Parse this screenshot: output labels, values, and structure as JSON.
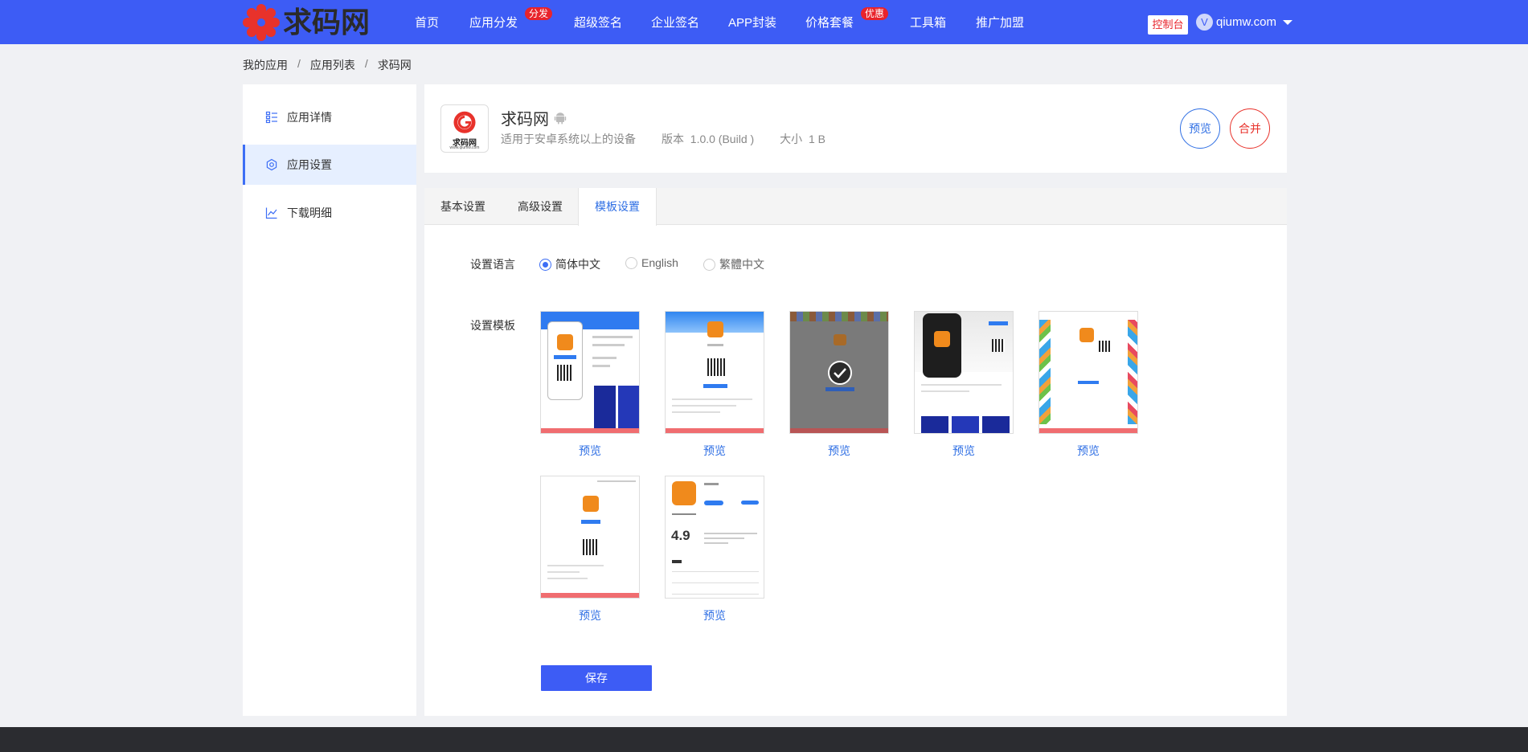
{
  "header": {
    "logo_text": "求码网",
    "nav": [
      {
        "label": "首页"
      },
      {
        "label": "应用分发",
        "badge": "分发"
      },
      {
        "label": "超级签名"
      },
      {
        "label": "企业签名"
      },
      {
        "label": "APP封装"
      },
      {
        "label": "价格套餐",
        "badge": "优惠"
      },
      {
        "label": "工具箱"
      },
      {
        "label": "推广加盟"
      }
    ],
    "console_label": "控制台",
    "avatar_letter": "V",
    "username": "qiumw.com"
  },
  "breadcrumb": {
    "items": [
      "我的应用",
      "应用列表",
      "求码网"
    ],
    "separator": "/"
  },
  "sidebar": {
    "items": [
      {
        "label": "应用详情",
        "icon": "list-icon"
      },
      {
        "label": "应用设置",
        "icon": "gear-icon",
        "active": true
      },
      {
        "label": "下载明细",
        "icon": "chart-icon"
      }
    ]
  },
  "app": {
    "name": "求码网",
    "platform_icon": "android-icon",
    "logo_caption": "求码网",
    "logo_url_text": "www.qiumw.com",
    "compat": "适用于安卓系统以上的设备",
    "version_label": "版本",
    "version": "1.0.0 (Build )",
    "size_label": "大小",
    "size": "1 B",
    "preview_button": "预览",
    "merge_button": "合并"
  },
  "tabs": [
    {
      "label": "基本设置"
    },
    {
      "label": "高级设置"
    },
    {
      "label": "模板设置",
      "active": true
    }
  ],
  "settings": {
    "language_label": "设置语言",
    "languages": [
      {
        "label": "简体中文",
        "selected": true
      },
      {
        "label": "English",
        "selected": false
      },
      {
        "label": "繁體中文",
        "selected": false
      }
    ],
    "template_label": "设置模板",
    "templates": [
      {
        "link": "预览",
        "selected": false
      },
      {
        "link": "预览",
        "selected": false
      },
      {
        "link": "预览",
        "selected": true
      },
      {
        "link": "预览",
        "selected": false
      },
      {
        "link": "预览",
        "selected": false
      },
      {
        "link": "预览",
        "selected": false
      },
      {
        "link": "预览",
        "selected": false,
        "rating": "4.9"
      }
    ],
    "save_button": "保存"
  },
  "colors": {
    "primary": "#3d5cf5",
    "link": "#2f6fe4",
    "danger": "#e8232b"
  }
}
